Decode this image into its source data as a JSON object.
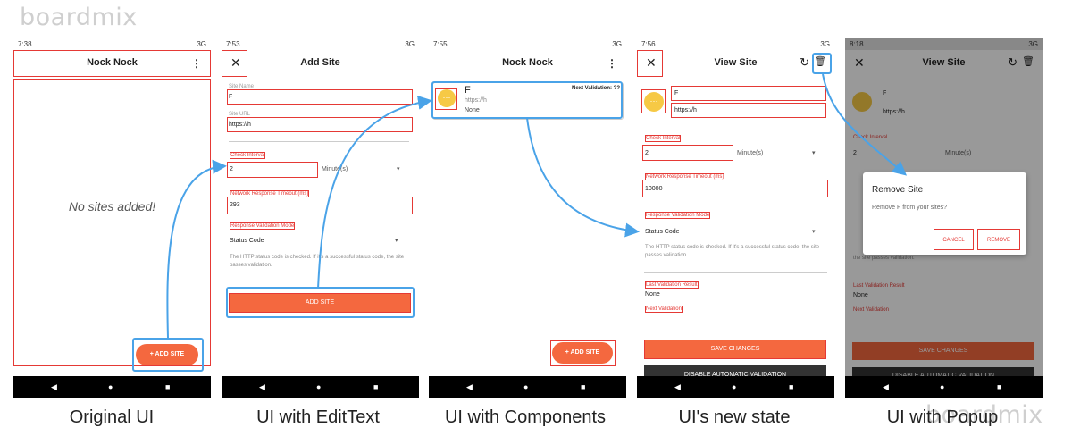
{
  "watermark": "boardmix",
  "captions": [
    "Original UI",
    "UI with EditText",
    "UI with Components",
    "UI's new state",
    "UI with Popup"
  ],
  "status": {
    "t1": "7:38",
    "t2": "7:53",
    "t3": "7:55",
    "t4": "7:56",
    "t5": "8:18",
    "net": "3G"
  },
  "nav": {
    "back": "◀",
    "home": "●",
    "recent": "■"
  },
  "s1": {
    "title": "Nock Nock",
    "empty": "No sites added!",
    "fab": "+  ADD SITE"
  },
  "s2": {
    "title": "Add Site",
    "site_name_label": "Site Name",
    "site_name_value": "F",
    "site_url_label": "Site URL",
    "site_url_value": "https://h",
    "check_interval_label": "Check Interval",
    "check_interval_value": "2",
    "unit": "Minute(s)",
    "timeout_label": "Network Response Timeout (ms)",
    "timeout_value": "293",
    "mode_label": "Response Validation Mode",
    "mode_value": "Status Code",
    "mode_desc": "The HTTP status code is checked. If it's a successful status code, the site passes validation.",
    "add_btn": "ADD SITE"
  },
  "s3": {
    "title": "Nock Nock",
    "name": "F",
    "url": "https://h",
    "status": "None",
    "next": "Next Validation: ??",
    "fab": "+  ADD SITE"
  },
  "s4": {
    "title": "View Site",
    "name": "F",
    "url": "https://h",
    "check_interval_label": "Check Interval",
    "check_interval_value": "2",
    "unit": "Minute(s)",
    "timeout_label": "Network Response Timeout (ms)",
    "timeout_value": "10000",
    "mode_label": "Response Validation Mode",
    "mode_value": "Status Code",
    "mode_desc": "The HTTP status code is checked. If it's a successful status code, the site passes validation.",
    "last_label": "Last Validation Result",
    "last_value": "None",
    "next_label": "Next Validation",
    "save_btn": "SAVE CHANGES",
    "disable_btn": "DISABLE AUTOMATIC VALIDATION"
  },
  "s5": {
    "title": "View Site",
    "name": "F",
    "url": "https://h",
    "check_interval_label": "Check Interval",
    "check_interval_value": "2",
    "unit": "Minute(s)",
    "desc": "the site passes validation.",
    "last_label": "Last Validation Result",
    "last_value": "None",
    "next_label": "Next Validation",
    "save_btn": "SAVE CHANGES",
    "disable_btn": "DISABLE AUTOMATIC VALIDATION",
    "dialog_title": "Remove Site",
    "dialog_msg": "Remove F from your sites?",
    "cancel": "CANCEL",
    "remove": "REMOVE"
  },
  "colors": {
    "accent": "#f4683f",
    "annotation_red": "#e53935",
    "annotation_blue": "#4aa3e8"
  }
}
